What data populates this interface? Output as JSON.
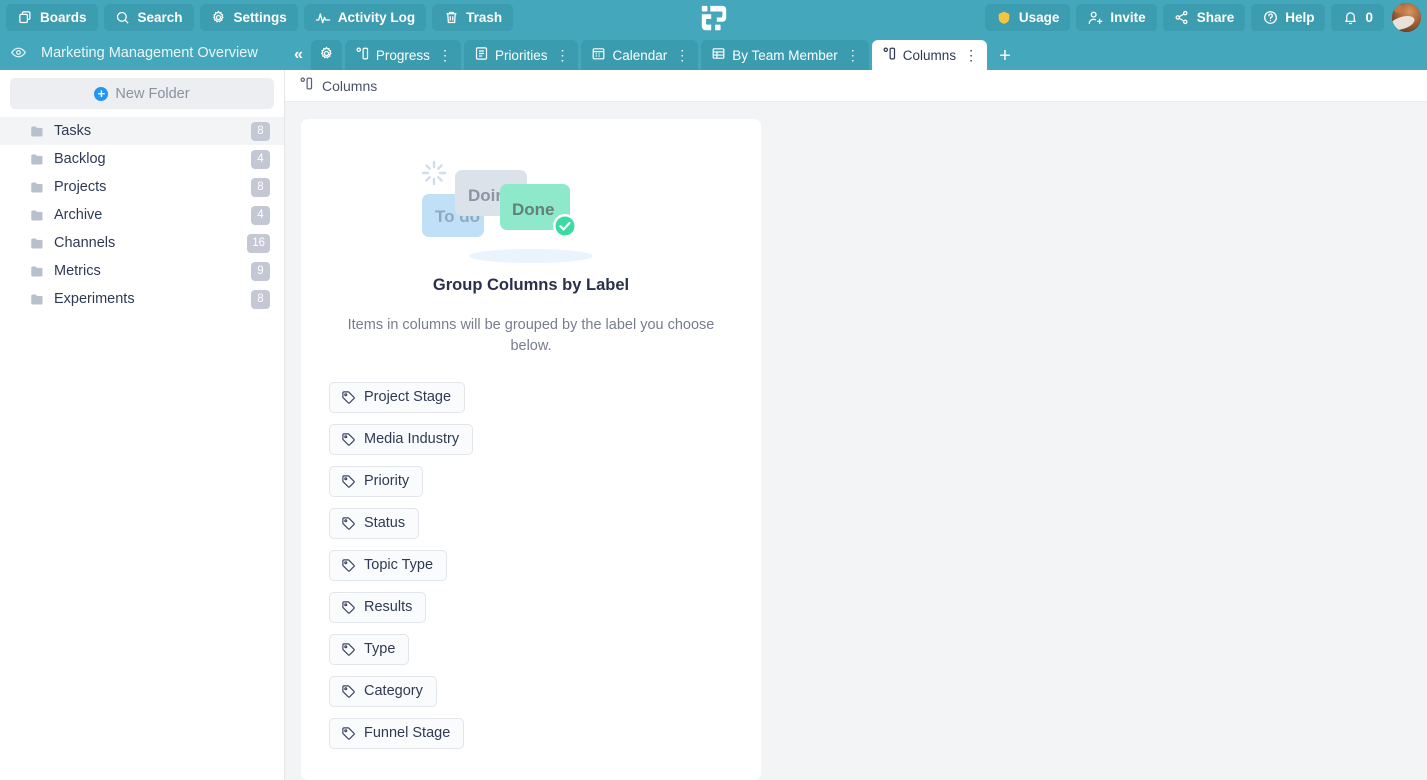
{
  "topbar": {
    "left_buttons": [
      {
        "label": "Boards",
        "icon": "boards-icon"
      },
      {
        "label": "Search",
        "icon": "search-icon"
      },
      {
        "label": "Settings",
        "icon": "gear-icon"
      },
      {
        "label": "Activity Log",
        "icon": "activity-icon"
      },
      {
        "label": "Trash",
        "icon": "trash-icon"
      }
    ],
    "right_buttons": [
      {
        "label": "Usage",
        "icon": "shield-icon"
      },
      {
        "label": "Invite",
        "icon": "user-add-icon"
      },
      {
        "label": "Share",
        "icon": "share-icon"
      },
      {
        "label": "Help",
        "icon": "question-circle-icon"
      },
      {
        "label": "0",
        "icon": "bell-icon"
      }
    ],
    "logo": "logo-icon",
    "avatar": "user-avatar",
    "bar_color": "#44a7bb",
    "button_color": "#3c9cb0",
    "usage_icon_color": "#f5c542"
  },
  "board": {
    "title": "Marketing Management Overview",
    "eye_icon": "eye-icon",
    "collapse_icon": "collapse-left-icon"
  },
  "tabs": {
    "settings_tab_icon": "gear-icon",
    "items": [
      {
        "label": "Progress",
        "icon": "columns-icon",
        "active": false
      },
      {
        "label": "Priorities",
        "icon": "list-icon",
        "active": false
      },
      {
        "label": "Calendar",
        "icon": "calendar-icon",
        "active": false
      },
      {
        "label": "By Team Member",
        "icon": "table-icon",
        "active": false
      },
      {
        "label": "Columns",
        "icon": "columns-icon",
        "active": true
      }
    ],
    "add_label": "+",
    "menu_dots": "⋮"
  },
  "sidebar": {
    "new_folder_label": "New Folder",
    "new_folder_icon": "plus-circle-icon",
    "folders": [
      {
        "name": "Tasks",
        "count": "8",
        "selected": true
      },
      {
        "name": "Backlog",
        "count": "4",
        "selected": false
      },
      {
        "name": "Projects",
        "count": "8",
        "selected": false
      },
      {
        "name": "Archive",
        "count": "4",
        "selected": false
      },
      {
        "name": "Channels",
        "count": "16",
        "selected": false
      },
      {
        "name": "Metrics",
        "count": "9",
        "selected": false
      },
      {
        "name": "Experiments",
        "count": "8",
        "selected": false
      }
    ]
  },
  "breadcrumb": {
    "icon": "columns-icon",
    "text": "Columns"
  },
  "main": {
    "illustration": {
      "cards": [
        {
          "label": "To do",
          "color": "#bfe0f7",
          "text_color": "#8fa4b8"
        },
        {
          "label": "Doing",
          "color": "#dbe2ea",
          "text_color": "#8c95a5"
        },
        {
          "label": "Done",
          "color": "#8ee8ca",
          "text_color": "#5f7f77"
        }
      ],
      "check_icon": "check-circle-icon",
      "spinner_icon": "spinner-icon"
    },
    "heading": "Group Columns by Label",
    "description": "Items in columns will be grouped by the label you choose below.",
    "labels": [
      {
        "name": "Project Stage",
        "icon": "tag-icon"
      },
      {
        "name": "Media Industry",
        "icon": "tag-icon"
      },
      {
        "name": "Priority",
        "icon": "tag-icon"
      },
      {
        "name": "Status",
        "icon": "tag-icon"
      },
      {
        "name": "Topic Type",
        "icon": "tag-icon"
      },
      {
        "name": "Results",
        "icon": "tag-icon"
      },
      {
        "name": "Type",
        "icon": "tag-icon"
      },
      {
        "name": "Category",
        "icon": "tag-icon"
      },
      {
        "name": "Funnel Stage",
        "icon": "tag-icon"
      }
    ]
  }
}
